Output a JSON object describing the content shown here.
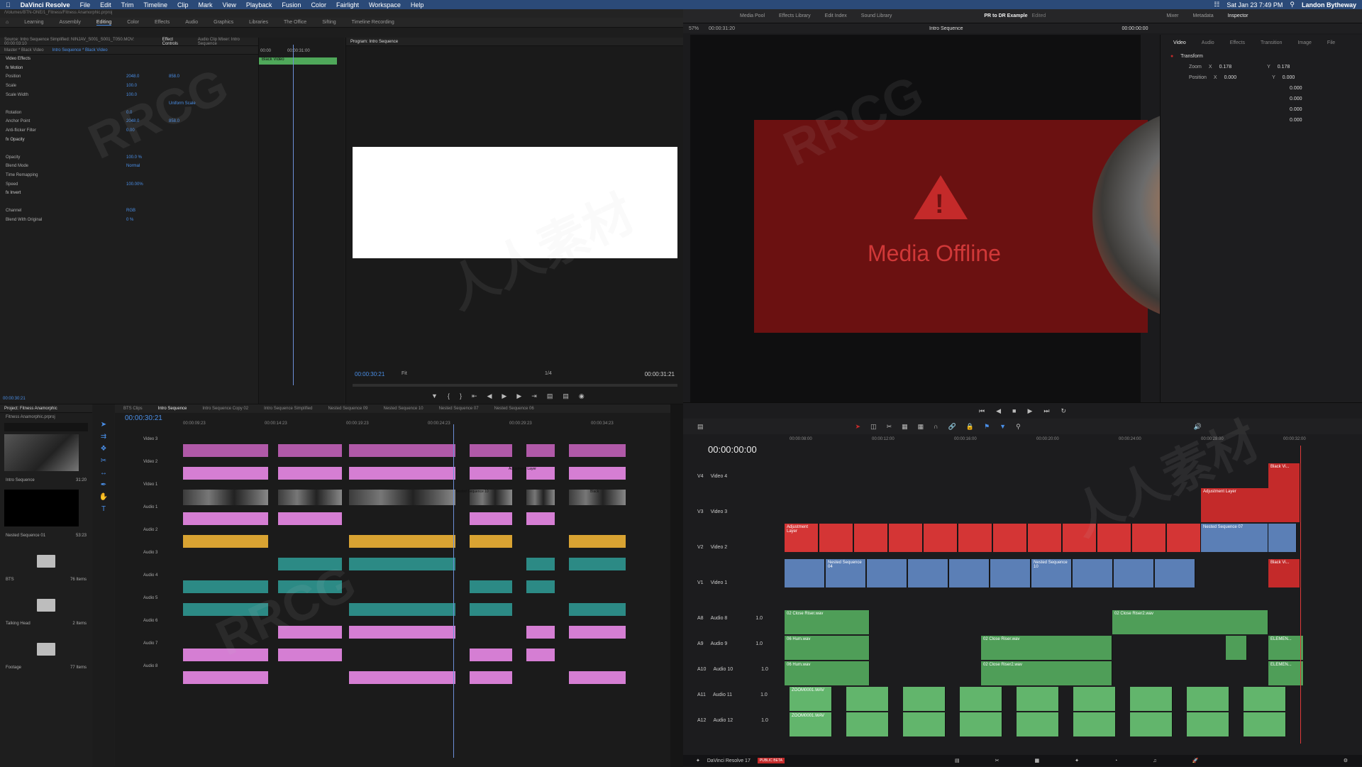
{
  "menubar": {
    "app": "DaVinci Resolve",
    "items": [
      "File",
      "Edit",
      "Trim",
      "Timeline",
      "Clip",
      "Mark",
      "View",
      "Playback",
      "Fusion",
      "Color",
      "Fairlight",
      "Workspace",
      "Help"
    ],
    "datetime": "Sat Jan 23  7:49 PM",
    "user": "Landon Bytheway"
  },
  "premiere": {
    "path": "/Volumes/BTN-ONE/1_Fitness/Fitness Anamorphic.prproj",
    "workspaces": [
      "Learning",
      "Assembly",
      "Editing",
      "Color",
      "Effects",
      "Audio",
      "Graphics",
      "Libraries",
      "The Office",
      "Sifting",
      "Timeline Recording"
    ],
    "active_workspace": "Editing",
    "source_label": "Source: Intro Sequence Simplified: NINJAV_S001_S001_T050.MOV: 00:00:03:10",
    "effect_controls_tab": "Effect Controls",
    "audio_mixer_tab": "Audio Clip Mixer: Intro Sequence",
    "master_label": "Master * Black Video",
    "sequence_label": "Intro Sequence * Black Video",
    "program_label": "Program: Intro Sequence",
    "effects": [
      {
        "label": "Video Effects",
        "v1": "",
        "v2": ""
      },
      {
        "label": "fx  Motion",
        "v1": "",
        "v2": ""
      },
      {
        "label": "Position",
        "v1": "2048.0",
        "v2": "858.0"
      },
      {
        "label": "Scale",
        "v1": "100.0",
        "v2": ""
      },
      {
        "label": "Scale Width",
        "v1": "100.0",
        "v2": ""
      },
      {
        "label": "",
        "v1": "",
        "v2": "Uniform Scale"
      },
      {
        "label": "Rotation",
        "v1": "0.0",
        "v2": ""
      },
      {
        "label": "Anchor Point",
        "v1": "2048.0",
        "v2": "858.0"
      },
      {
        "label": "Anti-flicker Filter",
        "v1": "0.00",
        "v2": ""
      },
      {
        "label": "fx  Opacity",
        "v1": "",
        "v2": ""
      },
      {
        "label": "",
        "v1": "",
        "v2": ""
      },
      {
        "label": "Opacity",
        "v1": "100.0 %",
        "v2": ""
      },
      {
        "label": "Blend Mode",
        "v1": "Normal",
        "v2": ""
      },
      {
        "label": "Time Remapping",
        "v1": "",
        "v2": ""
      },
      {
        "label": "Speed",
        "v1": "100.00%",
        "v2": ""
      },
      {
        "label": "fx  Invert",
        "v1": "",
        "v2": ""
      },
      {
        "label": "",
        "v1": "",
        "v2": ""
      },
      {
        "label": "Channel",
        "v1": "RGB",
        "v2": ""
      },
      {
        "label": "Blend With Original",
        "v1": "0 %",
        "v2": ""
      }
    ],
    "ec_clip": "Black Video",
    "ec_time_start": "00:00",
    "ec_time_mid": "00:00:31:00",
    "ec_bottom_tc": "00:00:30:21",
    "program_tc": "00:00:30:21",
    "program_fit": "Fit",
    "program_scale": "1/4",
    "program_duration": "00:00:31:21",
    "project": {
      "title": "Project: Fitness Anamorphic",
      "file": "Fitness Anamorphic.prproj",
      "items": [
        {
          "name": "Intro Sequence",
          "meta": "31:20"
        },
        {
          "name": "Nested Sequence 01",
          "meta": "53:23"
        },
        {
          "name": "BTS",
          "meta": "76 Items"
        },
        {
          "name": "Talking Head",
          "meta": "2 Items"
        },
        {
          "name": "Footage",
          "meta": "77 Items"
        }
      ]
    },
    "timeline_tabs": [
      "BTS Clips",
      "Intro Sequence",
      "Intro Sequence Copy 02",
      "Intro Sequence Simplified",
      "Nested Sequence 09",
      "Nested Sequence 10",
      "Nested Sequence 07",
      "Nested Sequence 06"
    ],
    "active_timeline_tab": "Intro Sequence",
    "timeline_tc": "00:00:30:21",
    "ruler": [
      "00:00:09:23",
      "00:00:14:23",
      "00:00:19:23",
      "00:00:24:23",
      "00:00:29:23",
      "00:00:34:23"
    ],
    "tracks": [
      "Video 3",
      "Video 2",
      "Video 1",
      "Audio 1",
      "Audio 2",
      "Audio 3",
      "Audio 4",
      "Audio 5",
      "Audio 6",
      "Audio 7",
      "Audio 8"
    ],
    "clip_adjustment": "Adjustment Layer",
    "clip_nested": "Nested Sequence 10",
    "clip_black": "Black"
  },
  "resolve": {
    "top_items": [
      "Media Pool",
      "Effects Library",
      "Edit Index",
      "Sound Library"
    ],
    "project_title": "PR to DR Example",
    "edited": "Edited",
    "right_items": [
      "Mixer",
      "Metadata",
      "Inspector"
    ],
    "zoom": "57%",
    "viewer_tc": "00:00:31:20",
    "timeline_name": "Intro Sequence",
    "viewer_tc_right": "00:00:00:00",
    "offline_text": "Media Offline",
    "inspector": {
      "tabs": [
        "Video",
        "Audio",
        "Effects",
        "Transition",
        "Image",
        "File"
      ],
      "section": "Transform",
      "zoom_x": "0.178",
      "zoom_y": "0.178",
      "position_x": "0.000",
      "position_y": "0.000",
      "extra": [
        "0.000",
        "0.000",
        "0.000",
        "0.000"
      ]
    },
    "timeline_tc": "00:00:00:00",
    "ruler": [
      "00:00:08:00",
      "00:00:12:00",
      "00:00:16:00",
      "00:00:20:00",
      "00:00:24:00",
      "00:00:28:00",
      "00:00:32:00"
    ],
    "video_tracks": [
      {
        "id": "V4",
        "name": "Video 4"
      },
      {
        "id": "V3",
        "name": "Video 3"
      },
      {
        "id": "V2",
        "name": "Video 2"
      },
      {
        "id": "V1",
        "name": "Video 1"
      }
    ],
    "audio_tracks": [
      {
        "id": "A8",
        "name": "Audio 8",
        "level": "1.0"
      },
      {
        "id": "A9",
        "name": "Audio 9",
        "level": "1.0"
      },
      {
        "id": "A10",
        "name": "Audio 10",
        "level": "1.0"
      },
      {
        "id": "A11",
        "name": "Audio 11",
        "level": "1.0"
      },
      {
        "id": "A12",
        "name": "Audio 12",
        "level": "1.0"
      }
    ],
    "clips": {
      "adjustment": "Adjustment Layer",
      "nested07": "Nested Sequence 07",
      "nested04": "Nested Sequence 04",
      "nested10": "Nested Sequence 10",
      "black": "Black Vi...",
      "riser": "02 Close Riser.wav",
      "riser2": "02 Close Riser2.wav",
      "hum": "06 Hum.wav",
      "zoom": "ZOOM0001.WAV",
      "element": "ELEMEN..."
    },
    "footer_app": "DaVinci Resolve 17",
    "footer_badge": "PUBLIC BETA"
  },
  "watermark": [
    "RRCG",
    "人人素材"
  ]
}
